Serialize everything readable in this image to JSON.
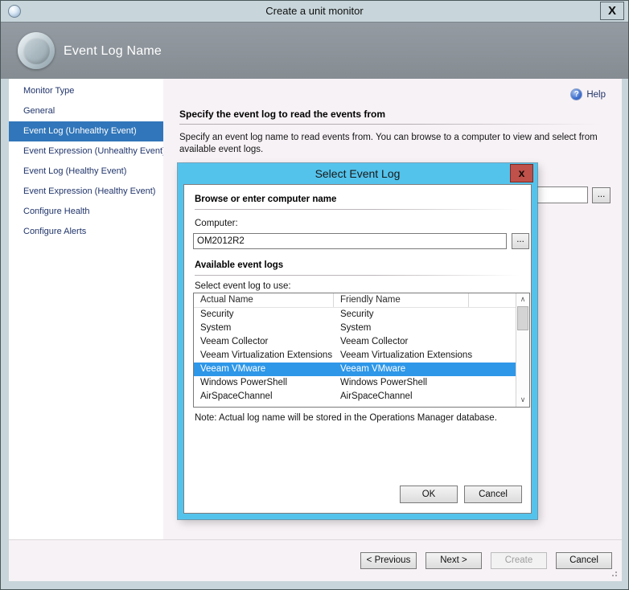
{
  "window": {
    "title": "Create a unit monitor",
    "close_label": "X"
  },
  "header": {
    "title": "Event Log Name"
  },
  "sidebar": {
    "items": [
      {
        "label": "Monitor Type",
        "selected": false
      },
      {
        "label": "General",
        "selected": false
      },
      {
        "label": "Event Log (Unhealthy Event)",
        "selected": true
      },
      {
        "label": "Event Expression (Unhealthy Event)",
        "selected": false
      },
      {
        "label": "Event Log (Healthy Event)",
        "selected": false
      },
      {
        "label": "Event Expression (Healthy Event)",
        "selected": false
      },
      {
        "label": "Configure Health",
        "selected": false
      },
      {
        "label": "Configure Alerts",
        "selected": false
      }
    ]
  },
  "main": {
    "help_label": "Help",
    "help_icon_glyph": "?",
    "heading": "Specify the event log to read the events from",
    "description": "Specify an event log name to read events from. You can browse to a computer to view and select from available event logs.",
    "browse_button_label": "..."
  },
  "dialog": {
    "title": "Select Event Log",
    "close_label": "x",
    "browse_section_heading": "Browse or enter computer name",
    "computer_label": "Computer:",
    "computer_value": "OM2012R2",
    "browse_button_label": "...",
    "logs_section_heading": "Available event logs",
    "select_label": "Select event log to use:",
    "table": {
      "columns": [
        "Actual Name",
        "Friendly Name"
      ],
      "rows": [
        {
          "actual": "Security",
          "friendly": "Security",
          "selected": false
        },
        {
          "actual": "System",
          "friendly": "System",
          "selected": false
        },
        {
          "actual": "Veeam Collector",
          "friendly": "Veeam Collector",
          "selected": false
        },
        {
          "actual": "Veeam Virtualization Extensions",
          "friendly": "Veeam Virtualization Extensions",
          "selected": false
        },
        {
          "actual": "Veeam VMware",
          "friendly": "Veeam VMware",
          "selected": true
        },
        {
          "actual": "Windows PowerShell",
          "friendly": "Windows PowerShell",
          "selected": false
        },
        {
          "actual": "AirSpaceChannel",
          "friendly": "AirSpaceChannel",
          "selected": false
        }
      ]
    },
    "scrollbar": {
      "up_glyph": "∧",
      "down_glyph": "∨"
    },
    "note": "Note: Actual log name will be stored in the Operations Manager database.",
    "ok_label": "OK",
    "cancel_label": "Cancel"
  },
  "footer": {
    "previous_label": "< Previous",
    "next_label": "Next >",
    "create_label": "Create",
    "cancel_label": "Cancel"
  },
  "colors": {
    "frame": "#c8d6db",
    "header_band": "#8a9198",
    "sidebar_selected": "#3176ba",
    "nav_text": "#21356b",
    "main_bg": "#f7f2f6",
    "dialog_border": "#54c3ec",
    "dialog_close": "#c0504a",
    "list_selection": "#2e97e8"
  }
}
